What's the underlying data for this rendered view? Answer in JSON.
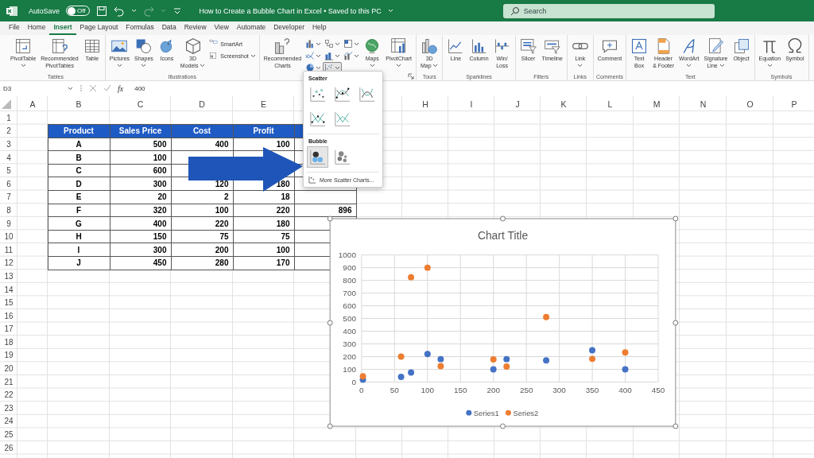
{
  "title_bar": {
    "autosave_label": "AutoSave",
    "autosave": {
      "on": false,
      "label": "Off"
    },
    "document_title": "How to Create a Bubble Chart in Excel • Saved to this PC",
    "search": {
      "placeholder": "Search"
    }
  },
  "tabs": [
    {
      "label": "File",
      "selected": false
    },
    {
      "label": "Home",
      "selected": false
    },
    {
      "label": "Insert",
      "selected": true
    },
    {
      "label": "Page Layout",
      "selected": false
    },
    {
      "label": "Formulas",
      "selected": false
    },
    {
      "label": "Data",
      "selected": false
    },
    {
      "label": "Review",
      "selected": false
    },
    {
      "label": "View",
      "selected": false
    },
    {
      "label": "Automate",
      "selected": false
    },
    {
      "label": "Developer",
      "selected": false
    },
    {
      "label": "Help",
      "selected": false
    }
  ],
  "ribbon": {
    "groups": [
      {
        "kind": "standard",
        "label": "Tables",
        "buttons": [
          {
            "label": "PivotTable",
            "dropdown": true
          },
          {
            "label": "Recommended\nPivotTables",
            "dropdown": false
          },
          {
            "label": "Table",
            "dropdown": false
          }
        ]
      },
      {
        "kind": "standard",
        "label": "Illustrations",
        "buttons": [
          {
            "label": "Pictures",
            "dropdown": true
          },
          {
            "label": "Shapes",
            "dropdown": true
          },
          {
            "label": "Icons",
            "dropdown": false
          },
          {
            "label": "3D\nModels",
            "dropdown": true
          }
        ],
        "small_buttons": [
          {
            "label": "SmartArt",
            "dropdown": false
          },
          {
            "label": "Screenshot",
            "dropdown": true
          }
        ]
      },
      {
        "kind": "charts",
        "lead_button": {
          "label": "Recommended\nCharts",
          "dropdown": false
        },
        "chart_type_buttons": [
          {
            "selected": false
          },
          {
            "selected": false
          },
          {
            "selected": false
          },
          {
            "selected": false
          },
          {
            "selected": false
          },
          {
            "selected": false
          },
          {
            "selected": false
          },
          {
            "selected": true
          }
        ],
        "buttons": [
          {
            "label": "Maps",
            "dropdown": true
          },
          {
            "label": "PivotChart",
            "dropdown": true
          }
        ]
      },
      {
        "kind": "standard",
        "label": "Tours",
        "buttons": [
          {
            "label": "3D\nMap",
            "dropdown": true
          }
        ]
      },
      {
        "kind": "standard",
        "label": "Sparklines",
        "buttons": [
          {
            "label": "Line",
            "dropdown": false
          },
          {
            "label": "Column",
            "dropdown": false
          },
          {
            "label": "Win/\nLoss",
            "dropdown": false
          }
        ]
      },
      {
        "kind": "standard",
        "label": "Filters",
        "buttons": [
          {
            "label": "Slicer",
            "dropdown": false
          },
          {
            "label": "Timeline",
            "dropdown": false
          }
        ]
      },
      {
        "kind": "standard",
        "label": "Links",
        "buttons": [
          {
            "label": "Link",
            "dropdown": true
          }
        ]
      },
      {
        "kind": "standard",
        "label": "Comments",
        "buttons": [
          {
            "label": "Comment",
            "dropdown": false
          }
        ]
      },
      {
        "kind": "standard",
        "label": "Text",
        "buttons": [
          {
            "label": "Text\nBox",
            "dropdown": false
          },
          {
            "label": "Header\n& Footer",
            "dropdown": false
          },
          {
            "label": "WordArt",
            "dropdown": true
          },
          {
            "label": "Signature\nLine",
            "dropdown": true
          },
          {
            "label": "Object",
            "dropdown": false
          }
        ]
      },
      {
        "kind": "standard",
        "label": "Symbols",
        "buttons": [
          {
            "label": "Equation",
            "dropdown": true
          },
          {
            "label": "Symbol",
            "dropdown": false
          }
        ]
      }
    ]
  },
  "formula_bar": {
    "name_box": "D3",
    "function_label": "fx",
    "value": "400"
  },
  "sheet": {
    "columns": [
      "A",
      "B",
      "C",
      "D",
      "E",
      null,
      null,
      "H",
      "I",
      "J",
      "K",
      "L",
      "M",
      "N",
      "O",
      "P"
    ],
    "rows": [
      "1",
      "2",
      "3",
      "4",
      "5",
      "6",
      "7",
      "8",
      "9",
      "10",
      "11",
      "12",
      "13",
      "14",
      "15",
      "16",
      "17",
      "18",
      "19",
      "20",
      "21",
      "22",
      "23",
      "24",
      "25",
      "26"
    ],
    "table": {
      "header": [
        "Product",
        "Sales Price",
        "Cost",
        "Profit"
      ],
      "rows": [
        {
          "product": "A",
          "sales_price": "500",
          "cost": "400",
          "profit": "100"
        },
        {
          "product": "B",
          "sales_price": "100"
        },
        {
          "product": "C",
          "sales_price": "600"
        },
        {
          "product": "D",
          "sales_price": "300",
          "cost": "120",
          "profit": "180"
        },
        {
          "product": "E",
          "sales_price": "20",
          "cost": "2",
          "profit": "18"
        },
        {
          "product": "F",
          "sales_price": "320",
          "cost": "100",
          "profit": "220",
          "column_f": "896"
        },
        {
          "product": "G",
          "sales_price": "400",
          "cost": "220",
          "profit": "180"
        },
        {
          "product": "H",
          "sales_price": "150",
          "cost": "75",
          "profit": "75"
        },
        {
          "product": "I",
          "sales_price": "300",
          "cost": "200",
          "profit": "100"
        },
        {
          "product": "J",
          "sales_price": "450",
          "cost": "280",
          "profit": "170"
        }
      ]
    },
    "callout_arrow": true
  },
  "scatter_menu": {
    "sections": [
      {
        "heading": "Scatter",
        "options": [
          {
            "selected": false
          },
          {
            "selected": false
          },
          {
            "selected": false
          },
          {
            "selected": false
          },
          {
            "selected": false
          }
        ]
      },
      {
        "heading": "Bubble",
        "options": [
          {
            "selected": true
          },
          {
            "selected": false
          }
        ]
      }
    ],
    "more_link": "More Scatter Charts..."
  },
  "chart": {
    "chart_data": {
      "type": "scatter",
      "title": "Chart Title",
      "x": [
        2,
        60,
        75,
        100,
        120,
        200,
        220,
        280,
        350,
        400
      ],
      "series": [
        {
          "name": "Series1",
          "color": "#4472c4",
          "values": [
            18,
            40,
            75,
            220,
            180,
            100,
            180,
            170,
            250,
            100
          ]
        },
        {
          "name": "Series2",
          "color": "#ed7d31",
          "values": [
            45,
            200,
            825,
            900,
            125,
            178,
            122,
            512,
            182,
            232
          ]
        }
      ],
      "xlim": [
        0,
        450
      ],
      "ylim": [
        0,
        1000
      ],
      "xticks": [
        0,
        50,
        100,
        150,
        200,
        250,
        300,
        350,
        400,
        450
      ],
      "yticks": [
        0,
        100,
        200,
        300,
        400,
        500,
        600,
        700,
        800,
        900,
        1000
      ],
      "grid": true,
      "legend": true
    }
  }
}
